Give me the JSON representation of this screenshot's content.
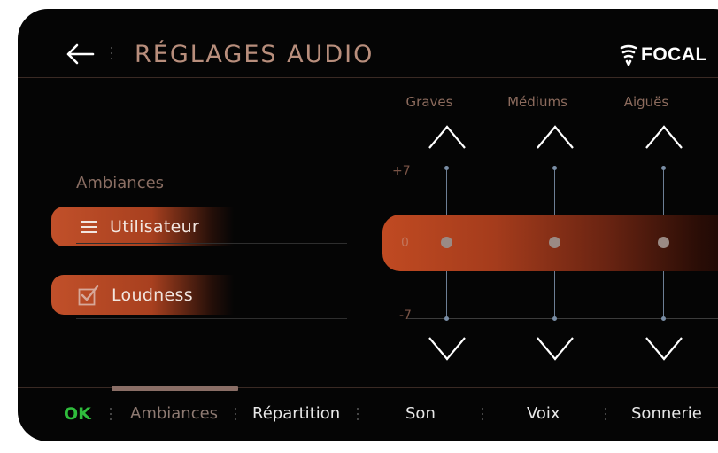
{
  "header": {
    "title": "RÉGLAGES AUDIO",
    "brand": "FOCAL",
    "back_icon": "arrow-left-icon"
  },
  "ambiances": {
    "label": "Ambiances",
    "preset": {
      "label": "Utilisateur",
      "icon": "menu-icon"
    },
    "loudness": {
      "label": "Loudness",
      "checked": true,
      "icon": "checkbox-checked-icon"
    }
  },
  "equalizer": {
    "bands": [
      {
        "name": "Graves",
        "value": 0
      },
      {
        "name": "Médiums",
        "value": 0
      },
      {
        "name": "Aiguës",
        "value": 0
      }
    ],
    "scale": {
      "max": "+7",
      "mid": "0",
      "min": "-7"
    },
    "up_icon": "chevron-up-icon",
    "down_icon": "chevron-down-icon"
  },
  "bottom_nav": {
    "ok": "OK",
    "tabs": [
      "Ambiances",
      "Répartition",
      "Son",
      "Voix",
      "Sonnerie"
    ],
    "active": "Ambiances",
    "colors": {
      "ok": "#2fbd3c",
      "accent": "#c1502a"
    }
  }
}
